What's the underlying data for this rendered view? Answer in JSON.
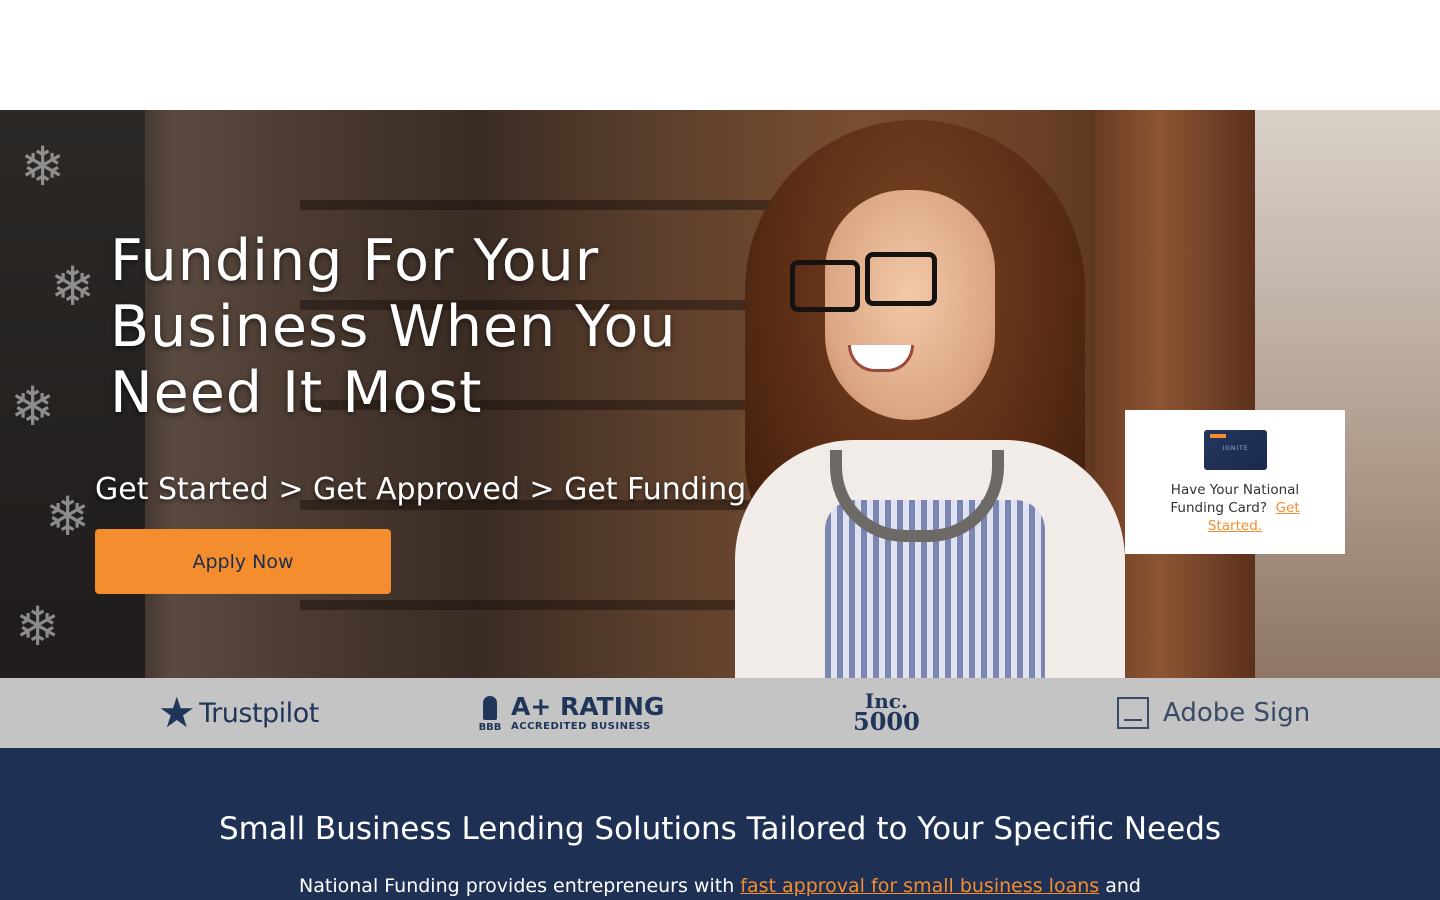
{
  "hero": {
    "title": "Funding For Your Business When You Need It Most",
    "steps": "Get Started > Get Approved > Get Funding",
    "cta_label": "Apply Now"
  },
  "card_promo": {
    "card_brand": "IGNITE",
    "text": "Have Your National Funding Card?",
    "link_label": "Get Started."
  },
  "logos": {
    "trustpilot": "Trustpilot",
    "bbb_mark": "BBB",
    "bbb_rating": "A+ RATING",
    "bbb_sub": "ACCREDITED BUSINESS",
    "inc_line1": "Inc.",
    "inc_line2": "5000",
    "adobe": "Adobe Sign"
  },
  "info": {
    "heading": "Small Business Lending Solutions Tailored to Your Specific Needs",
    "body_prefix": "National Funding provides entrepreneurs with",
    "body_link": "fast approval for small business loans",
    "body_suffix": "and"
  },
  "colors": {
    "accent": "#f48d2e",
    "navy": "#1e3155",
    "logo_bar": "#c4c4c4"
  }
}
